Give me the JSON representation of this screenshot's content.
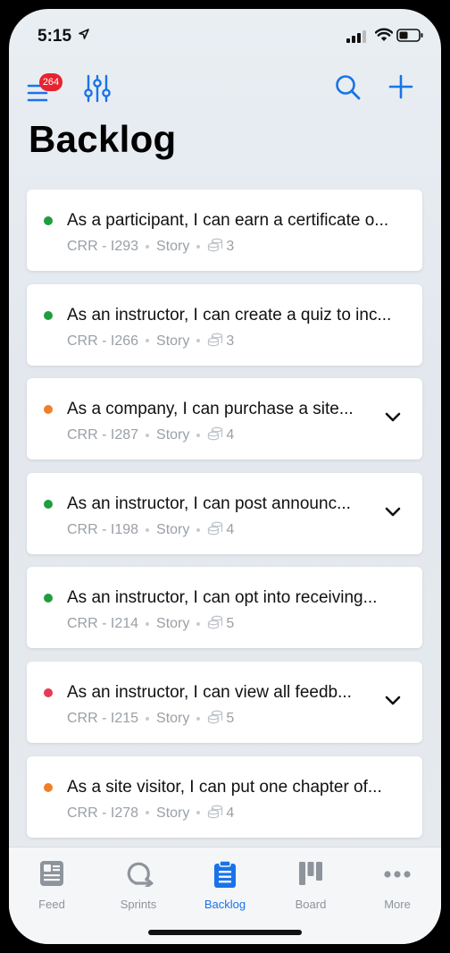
{
  "status_bar": {
    "time": "5:15"
  },
  "header": {
    "menu_badge_count": "264",
    "title": "Backlog"
  },
  "colors": {
    "accent": "#1a73e8",
    "green": "#1e9e3e",
    "orange": "#f07f2b",
    "red": "#e63a55",
    "badge": "#e8232f"
  },
  "items": [
    {
      "status_color": "#1e9e3e",
      "title": "As a participant, I can earn a certificate o...",
      "key": "CRR - I293",
      "type": "Story",
      "points": "3",
      "expandable": false
    },
    {
      "status_color": "#1e9e3e",
      "title": "As an instructor, I can create a quiz to inc...",
      "key": "CRR - I266",
      "type": "Story",
      "points": "3",
      "expandable": false
    },
    {
      "status_color": "#f07f2b",
      "title": "As a company, I can purchase a site...",
      "key": "CRR - I287",
      "type": "Story",
      "points": "4",
      "expandable": true
    },
    {
      "status_color": "#1e9e3e",
      "title": "As an instructor, I can post announc...",
      "key": "CRR - I198",
      "type": "Story",
      "points": "4",
      "expandable": true
    },
    {
      "status_color": "#1e9e3e",
      "title": "As an instructor, I can opt into receiving...",
      "key": "CRR - I214",
      "type": "Story",
      "points": "5",
      "expandable": false
    },
    {
      "status_color": "#e63a55",
      "title": "As an instructor, I can view all feedb...",
      "key": "CRR - I215",
      "type": "Story",
      "points": "5",
      "expandable": true
    },
    {
      "status_color": "#f07f2b",
      "title": "As a site visitor, I can put one chapter of...",
      "key": "CRR - I278",
      "type": "Story",
      "points": "4",
      "expandable": false
    }
  ],
  "tabs": [
    {
      "label": "Feed",
      "icon": "feed-icon",
      "active": false
    },
    {
      "label": "Sprints",
      "icon": "sprints-icon",
      "active": false
    },
    {
      "label": "Backlog",
      "icon": "backlog-icon",
      "active": true
    },
    {
      "label": "Board",
      "icon": "board-icon",
      "active": false
    },
    {
      "label": "More",
      "icon": "more-icon",
      "active": false
    }
  ]
}
